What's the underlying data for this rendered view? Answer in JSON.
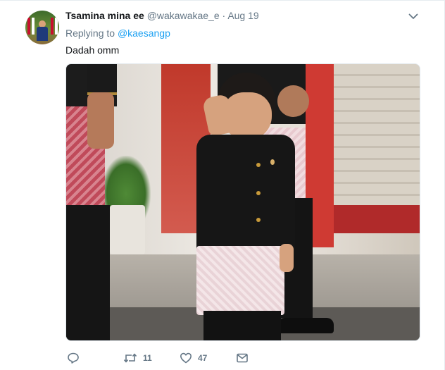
{
  "tweet": {
    "display_name": "Tsamina mina ee",
    "handle": "@wakawakae_e",
    "separator": "·",
    "date": "Aug 19",
    "replying_prefix": "Replying to",
    "replying_to": "@kaesangp",
    "text": "Dadah omm"
  },
  "actions": {
    "reply_count": "",
    "retweet_count": "11",
    "like_count": "47"
  },
  "icons": {
    "reply": "reply-icon",
    "retweet": "retweet-icon",
    "like": "heart-icon",
    "dm": "envelope-icon",
    "menu": "chevron-down-icon"
  },
  "colors": {
    "link": "#1da1f2",
    "secondary_text": "#657786",
    "primary_text": "#14171a"
  }
}
